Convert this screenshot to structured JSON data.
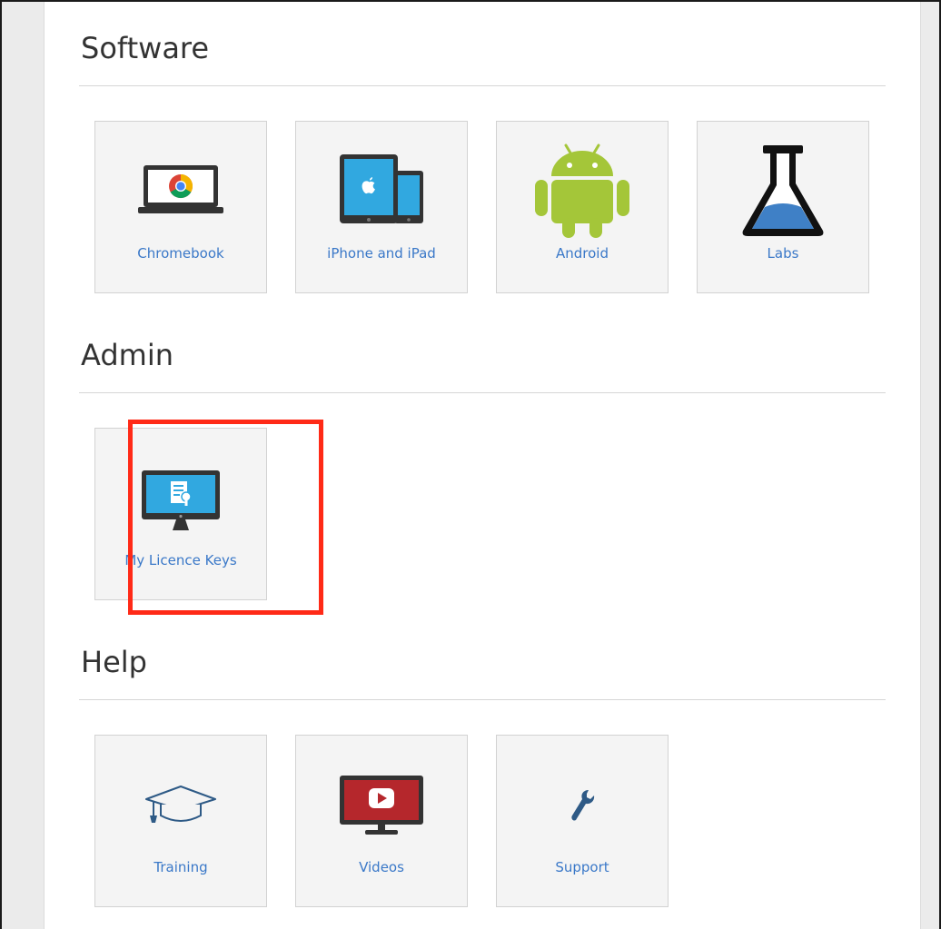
{
  "sections": {
    "software": {
      "title": "Software",
      "tiles": [
        {
          "label": "Chromebook",
          "icon": "chromebook-icon"
        },
        {
          "label": "iPhone and iPad",
          "icon": "iphone-ipad-icon"
        },
        {
          "label": "Android",
          "icon": "android-icon"
        },
        {
          "label": "Labs",
          "icon": "flask-icon"
        }
      ]
    },
    "admin": {
      "title": "Admin",
      "tiles": [
        {
          "label": "My Licence Keys",
          "icon": "licence-monitor-icon"
        }
      ]
    },
    "help": {
      "title": "Help",
      "tiles": [
        {
          "label": "Training",
          "icon": "graduation-cap-icon"
        },
        {
          "label": "Videos",
          "icon": "youtube-monitor-icon"
        },
        {
          "label": "Support",
          "icon": "wrench-icon"
        }
      ]
    }
  },
  "colors": {
    "link": "#3a78c8",
    "highlight": "#ff2a17",
    "tile_bg": "#f4f4f4",
    "android_green": "#a4c639",
    "flask_blue": "#3f80c6"
  }
}
